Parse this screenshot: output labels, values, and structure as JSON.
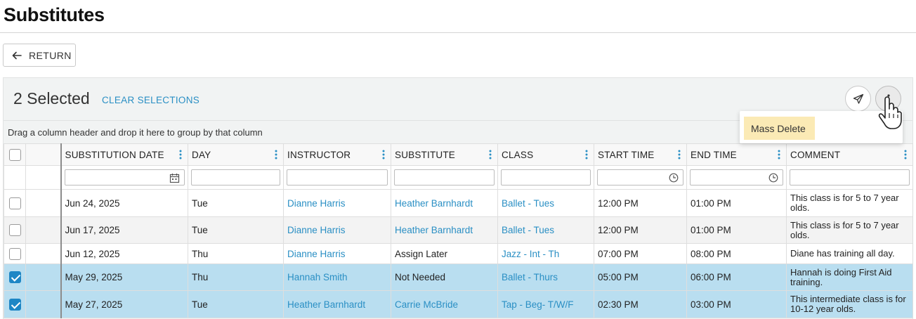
{
  "page": {
    "title": "Substitutes"
  },
  "return_button": {
    "label": "RETURN"
  },
  "toolbar": {
    "selected_text": "2 Selected",
    "clear_label": "CLEAR SELECTIONS",
    "send_icon": "paper-plane-icon",
    "more_icon": "kebab-icon"
  },
  "menu": {
    "items": [
      "Mass Delete"
    ]
  },
  "group_hint": "Drag a column header and drop it here to group by that column",
  "columns": [
    "SUBSTITUTION DATE",
    "DAY",
    "INSTRUCTOR",
    "SUBSTITUTE",
    "CLASS",
    "START TIME",
    "END TIME",
    "COMMENT"
  ],
  "rows": [
    {
      "checked": false,
      "date": "Jun 24, 2025",
      "day": "Tue",
      "instructor": "Dianne Harris",
      "substitute": "Heather Barnhardt",
      "substitute_link": true,
      "class": "Ballet - Tues",
      "start": "12:00 PM",
      "end": "01:00 PM",
      "comment": "This class is for 5 to 7 year olds."
    },
    {
      "checked": false,
      "date": "Jun 17, 2025",
      "day": "Tue",
      "instructor": "Dianne Harris",
      "substitute": "Heather Barnhardt",
      "substitute_link": true,
      "class": "Ballet - Tues",
      "start": "12:00 PM",
      "end": "01:00 PM",
      "comment": "This class is for 5 to 7 year olds."
    },
    {
      "checked": false,
      "date": "Jun 12, 2025",
      "day": "Thu",
      "instructor": "Dianne Harris",
      "substitute": "Assign Later",
      "substitute_link": false,
      "class": "Jazz - Int - Th",
      "start": "07:00 PM",
      "end": "08:00 PM",
      "comment": "Diane has training all day."
    },
    {
      "checked": true,
      "date": "May 29, 2025",
      "day": "Thu",
      "instructor": "Hannah Smith",
      "substitute": "Not Needed",
      "substitute_link": false,
      "class": "Ballet - Thurs",
      "start": "05:00 PM",
      "end": "06:00 PM",
      "comment": "Hannah is doing First Aid training."
    },
    {
      "checked": true,
      "date": "May 27, 2025",
      "day": "Tue",
      "instructor": "Heather Barnhardt",
      "substitute": "Carrie McBride",
      "substitute_link": true,
      "class": "Tap - Beg- T/W/F",
      "start": "02:30 PM",
      "end": "03:00 PM",
      "comment": "This intermediate class is for 10-12 year olds."
    }
  ],
  "colors": {
    "accent": "#2a8fc4",
    "selected_row": "#b9def0",
    "menu_highlight": "#fbeab5",
    "checkbox": "#1e86c5"
  }
}
